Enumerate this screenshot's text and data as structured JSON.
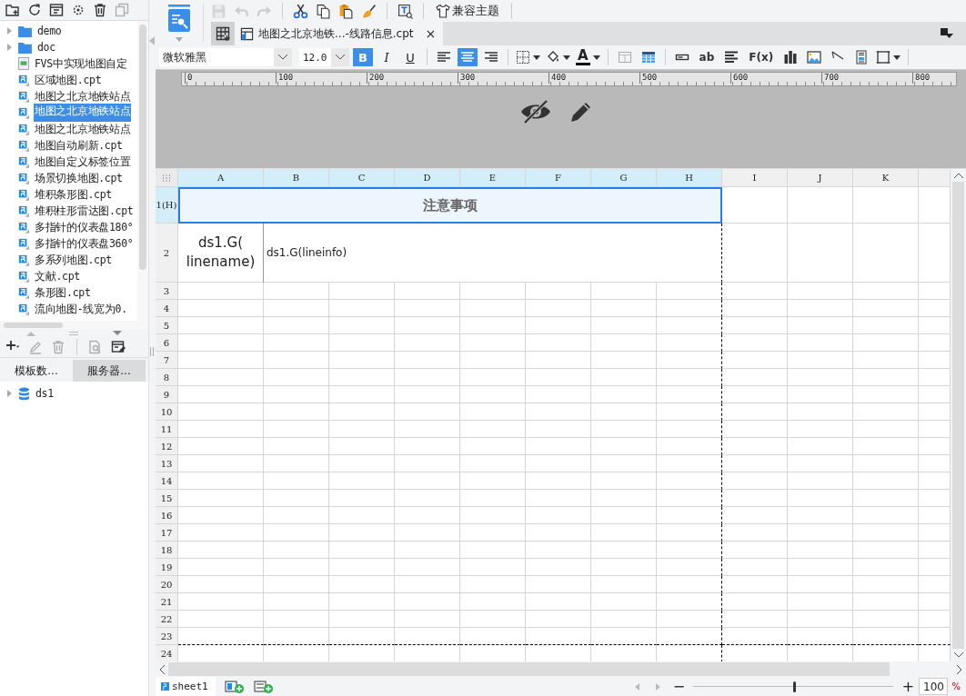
{
  "left_toolbar": [
    {
      "disabled": false
    },
    {
      "disabled": false
    },
    {
      "disabled": false
    },
    {
      "disabled": false
    },
    {
      "disabled": false
    },
    {
      "disabled": true
    }
  ],
  "file_tree": [
    {
      "label": "demo",
      "kind": "folder",
      "selected": false,
      "expanded": false
    },
    {
      "label": "doc",
      "kind": "folder",
      "selected": false,
      "expanded": false
    },
    {
      "label": "FVS中实现地图自定",
      "kind": "fvs",
      "selected": false
    },
    {
      "label": "区域地图.cpt",
      "kind": "template",
      "selected": false
    },
    {
      "label": "地图之北京地铁站点",
      "kind": "template",
      "selected": false
    },
    {
      "label": "地图之北京地铁站点",
      "kind": "template",
      "selected": true
    },
    {
      "label": "地图之北京地铁站点",
      "kind": "template",
      "selected": false
    },
    {
      "label": "地图自动刷新.cpt",
      "kind": "template",
      "selected": false
    },
    {
      "label": "地图自定义标签位置",
      "kind": "template",
      "selected": false
    },
    {
      "label": "场景切换地图.cpt",
      "kind": "template",
      "selected": false
    },
    {
      "label": "堆积条形图.cpt",
      "kind": "template",
      "selected": false
    },
    {
      "label": "堆积柱形雷达图.cpt",
      "kind": "template",
      "selected": false
    },
    {
      "label": "多指针的仪表盘180°",
      "kind": "template",
      "selected": false
    },
    {
      "label": "多指针的仪表盘360°",
      "kind": "template",
      "selected": false
    },
    {
      "label": "多系列地图.cpt",
      "kind": "template",
      "selected": false
    },
    {
      "label": "文献.cpt",
      "kind": "template",
      "selected": false
    },
    {
      "label": "条形图.cpt",
      "kind": "template",
      "selected": false
    },
    {
      "label": "流向地图-线宽为0.",
      "kind": "template",
      "selected": false
    }
  ],
  "dataset_toolbar": [
    {
      "disabled": false
    },
    {
      "disabled": true
    },
    {
      "disabled": true
    },
    {
      "disabled": true
    },
    {
      "disabled": false
    }
  ],
  "panel_tabs": [
    {
      "label": "模板数...",
      "selected": true
    },
    {
      "label": "服务器...",
      "selected": false
    }
  ],
  "datasets": [
    {
      "label": "ds1",
      "expanded": false
    }
  ],
  "main_toolbar": [
    {
      "kind": "icon",
      "disabled": true
    },
    {
      "kind": "icon",
      "disabled": true
    },
    {
      "kind": "icon",
      "disabled": true
    },
    {
      "kind": "sep"
    },
    {
      "kind": "icon",
      "disabled": false
    },
    {
      "kind": "icon",
      "disabled": false
    },
    {
      "kind": "icon",
      "disabled": false
    },
    {
      "kind": "icon",
      "disabled": false
    },
    {
      "kind": "sep"
    },
    {
      "kind": "icon",
      "disabled": false
    },
    {
      "kind": "sep"
    },
    {
      "kind": "labeled",
      "label": "兼容主题",
      "disabled": false
    }
  ],
  "editor_tabs": [
    {
      "label": "地图之北京地铁...-线路信息.cpt",
      "close": "×",
      "selected": true
    }
  ],
  "format_toolbar": [
    {
      "kind": "font-select",
      "value": "微软雅黑"
    },
    {
      "kind": "size-select",
      "value": "12.0"
    },
    {
      "kind": "toggle",
      "label": "B",
      "selected": true
    },
    {
      "kind": "toggle",
      "label": "I",
      "selected": false
    },
    {
      "kind": "toggle",
      "label": "U",
      "selected": false
    },
    {
      "kind": "sep"
    },
    {
      "kind": "icon",
      "selected": false
    },
    {
      "kind": "icon",
      "selected": true
    },
    {
      "kind": "icon",
      "selected": false
    },
    {
      "kind": "sep"
    },
    {
      "kind": "icon",
      "selected": false
    },
    {
      "kind": "icon",
      "selected": false
    },
    {
      "kind": "font-color",
      "label": "A"
    },
    {
      "kind": "sep"
    },
    {
      "kind": "icon",
      "selected": false
    },
    {
      "kind": "icon",
      "selected": false
    },
    {
      "kind": "sep"
    },
    {
      "kind": "icon",
      "selected": false
    },
    {
      "kind": "text",
      "label": "ab"
    },
    {
      "kind": "icon",
      "selected": false
    },
    {
      "kind": "text",
      "label": "F(x)"
    },
    {
      "kind": "icon",
      "selected": false
    },
    {
      "kind": "icon",
      "selected": false
    },
    {
      "kind": "icon",
      "selected": false
    },
    {
      "kind": "icon",
      "selected": false
    },
    {
      "kind": "icon",
      "selected": false
    },
    {
      "kind": "sep"
    }
  ],
  "ruler": {
    "ticks": [
      "0",
      "100",
      "200",
      "300",
      "400",
      "500",
      "600",
      "700",
      "800"
    ]
  },
  "sheet": {
    "columns": [
      {
        "label": "A",
        "selected": true
      },
      {
        "label": "B",
        "selected": true
      },
      {
        "label": "C",
        "selected": true
      },
      {
        "label": "D",
        "selected": true
      },
      {
        "label": "E",
        "selected": true
      },
      {
        "label": "F",
        "selected": true
      },
      {
        "label": "G",
        "selected": true
      },
      {
        "label": "H",
        "selected": true,
        "page_break": true
      },
      {
        "label": "I",
        "selected": false
      },
      {
        "label": "J",
        "selected": false
      },
      {
        "label": "K",
        "selected": false
      }
    ],
    "rows": [
      {
        "label": "1(H)",
        "kind": "title",
        "selected": true,
        "cells": [
          {
            "text": "注意事项",
            "selected": true
          }
        ]
      },
      {
        "label": "2",
        "kind": "data",
        "selected": false,
        "cells": [
          {
            "text": "ds1.G(\nlinename)"
          },
          {
            "text": "ds1.G(lineinfo)"
          }
        ]
      },
      {
        "label": "3",
        "kind": "empty",
        "selected": false
      },
      {
        "label": "4",
        "kind": "empty",
        "selected": false
      },
      {
        "label": "5",
        "kind": "empty",
        "selected": false
      },
      {
        "label": "6",
        "kind": "empty",
        "selected": false
      },
      {
        "label": "7",
        "kind": "empty",
        "selected": false
      },
      {
        "label": "8",
        "kind": "empty",
        "selected": false
      },
      {
        "label": "9",
        "kind": "empty",
        "selected": false
      },
      {
        "label": "10",
        "kind": "empty",
        "selected": false
      },
      {
        "label": "11",
        "kind": "empty",
        "selected": false
      },
      {
        "label": "12",
        "kind": "empty",
        "selected": false
      },
      {
        "label": "13",
        "kind": "empty",
        "selected": false
      },
      {
        "label": "14",
        "kind": "empty",
        "selected": false
      },
      {
        "label": "15",
        "kind": "empty",
        "selected": false
      },
      {
        "label": "16",
        "kind": "empty",
        "selected": false
      },
      {
        "label": "17",
        "kind": "empty",
        "selected": false
      },
      {
        "label": "18",
        "kind": "empty",
        "selected": false
      },
      {
        "label": "19",
        "kind": "empty",
        "selected": false
      },
      {
        "label": "20",
        "kind": "empty",
        "selected": false
      },
      {
        "label": "21",
        "kind": "empty",
        "selected": false
      },
      {
        "label": "22",
        "kind": "empty",
        "selected": false
      },
      {
        "label": "23",
        "kind": "empty",
        "selected": false,
        "page_break": true
      },
      {
        "label": "24",
        "kind": "empty",
        "selected": false
      }
    ]
  },
  "sheet_tabs": [
    {
      "label": "sheet1",
      "selected": true
    }
  ],
  "zoom": {
    "minus": "−",
    "plus": "+",
    "value": "100",
    "unit": "%",
    "level": 0.5
  }
}
